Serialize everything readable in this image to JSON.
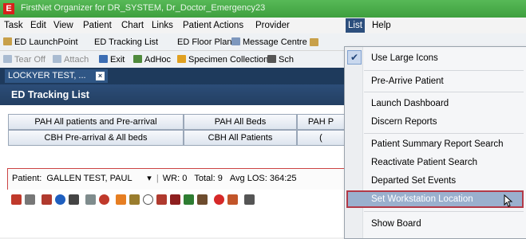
{
  "window": {
    "title": "FirstNet Organizer for DR_SYSTEM, Dr_Doctor_Emergency23",
    "app_icon_letter": "E"
  },
  "menubar": {
    "items": [
      "Task",
      "Edit",
      "View",
      "Patient",
      "Chart",
      "Links",
      "Patient Actions",
      "Provider",
      "List",
      "Help"
    ]
  },
  "toolbar1": {
    "items": [
      "ED LaunchPoint",
      "ED Tracking List",
      "ED Floor Plan",
      "Message Centre"
    ]
  },
  "toolbar2": {
    "items": [
      "Tear Off",
      "Attach",
      "Exit",
      "AdHoc",
      "Specimen Collection",
      "Sch"
    ]
  },
  "patient_tab": {
    "label": "LOCKYER TEST, ...",
    "close": "×"
  },
  "header": {
    "title": "ED Tracking List"
  },
  "group_tabs": {
    "row1": [
      "PAH All patients and Pre-arrival",
      "PAH All Beds",
      "PAH P"
    ],
    "row2": [
      "CBH Pre-arrival & All beds",
      "CBH All Patients",
      "("
    ]
  },
  "filter_bar": {
    "patient_label": "Patient:",
    "patient_value": "GALLEN TEST, PAUL",
    "wr": "WR: 0",
    "total": "Total: 9",
    "avg_los": "Avg LOS: 364:25"
  },
  "list_menu": {
    "items": [
      {
        "label": "Use Large Icons",
        "checked": true
      },
      {
        "label": "Pre-Arrive Patient"
      },
      {
        "label": "Launch Dashboard"
      },
      {
        "label": "Discern Reports"
      },
      {
        "label": "Patient Summary Report Search"
      },
      {
        "label": "Reactivate Patient Search"
      },
      {
        "label": "Departed Set Events"
      },
      {
        "label": "Set Workstation Location",
        "highlighted": true
      },
      {
        "label": "Show Board"
      }
    ]
  },
  "colors": {
    "title_bar": "#4caf50",
    "header": "#2c4d78",
    "highlight_border": "#b23a48",
    "menu_active": "#2d4f7d"
  }
}
